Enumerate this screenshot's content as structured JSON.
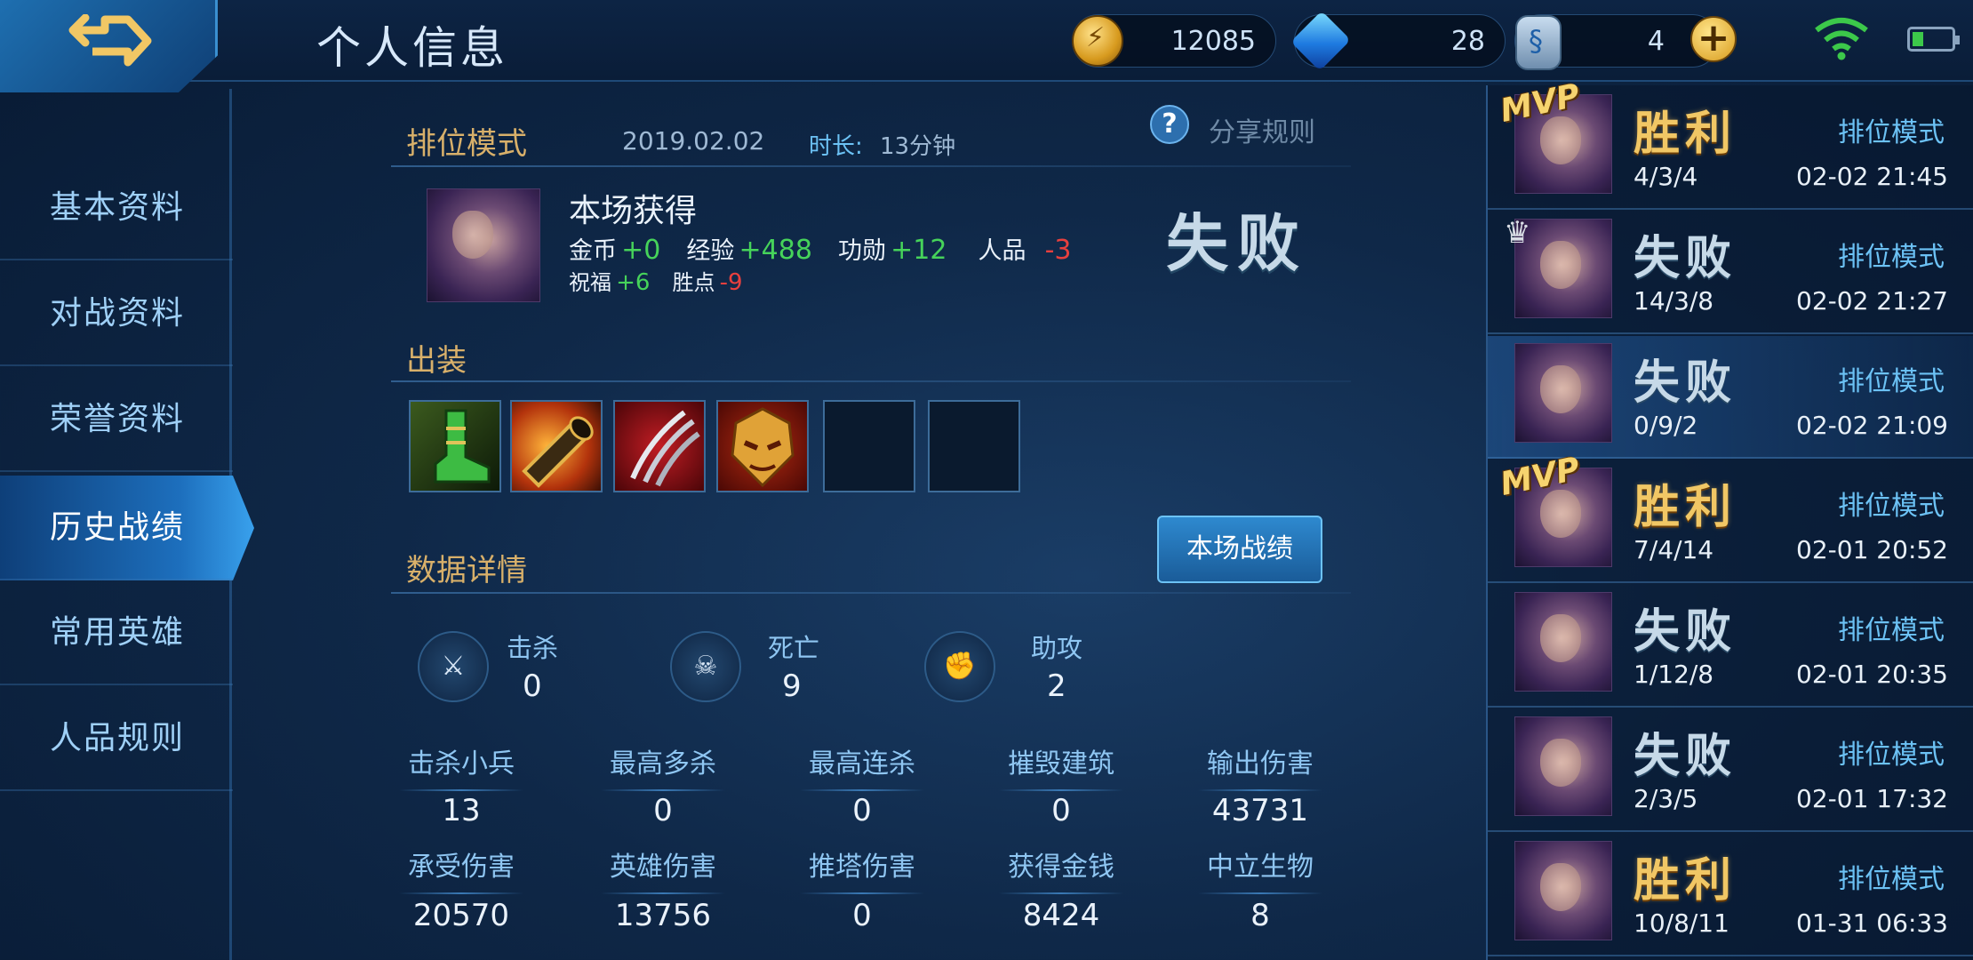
{
  "header": {
    "title": "个人信息"
  },
  "currency": {
    "gold": "12085",
    "diamond": "28",
    "coupon": "4"
  },
  "nav": {
    "items": [
      "基本资料",
      "对战资料",
      "荣誉资料",
      "历史战绩",
      "常用英雄",
      "人品规则"
    ],
    "active_index": 3
  },
  "match": {
    "mode": "排位模式",
    "date": "2019.02.02",
    "duration_label": "时长:",
    "duration": "13分钟",
    "share_rules": "分享规则",
    "rewards_title": "本场获得",
    "result": "失败",
    "rewards": {
      "gold_label": "金币",
      "gold": "+0",
      "exp_label": "经验",
      "exp": "+488",
      "merit_label": "功勋",
      "merit": "+12",
      "karma_label": "人品",
      "karma": "-3",
      "bless_label": "祝福",
      "bless": "+6",
      "points_label": "胜点",
      "points": "-9"
    },
    "equipment_title": "出装",
    "items": [
      "boots-icon",
      "horn-icon",
      "claw-icon",
      "mask-icon",
      "",
      ""
    ],
    "detail_title": "数据详情",
    "detail_button": "本场战绩",
    "kda": {
      "kill_label": "击杀",
      "kill": "0",
      "death_label": "死亡",
      "death": "9",
      "assist_label": "助攻",
      "assist": "2"
    },
    "stats": [
      {
        "label": "击杀小兵",
        "value": "13"
      },
      {
        "label": "最高多杀",
        "value": "0"
      },
      {
        "label": "最高连杀",
        "value": "0"
      },
      {
        "label": "摧毁建筑",
        "value": "0"
      },
      {
        "label": "输出伤害",
        "value": "43731"
      },
      {
        "label": "承受伤害",
        "value": "20570"
      },
      {
        "label": "英雄伤害",
        "value": "13756"
      },
      {
        "label": "推塔伤害",
        "value": "0"
      },
      {
        "label": "获得金钱",
        "value": "8424"
      },
      {
        "label": "中立生物",
        "value": "8"
      }
    ]
  },
  "history": [
    {
      "badge": "MVP",
      "result": "胜利",
      "outcome": "win",
      "mode": "排位模式",
      "kda": "4/3/4",
      "time": "02-02 21:45"
    },
    {
      "badge": "crown",
      "result": "失败",
      "outcome": "loss",
      "mode": "排位模式",
      "kda": "14/3/8",
      "time": "02-02 21:27"
    },
    {
      "badge": "",
      "result": "失败",
      "outcome": "loss",
      "mode": "排位模式",
      "kda": "0/9/2",
      "time": "02-02 21:09",
      "selected": true
    },
    {
      "badge": "MVP",
      "result": "胜利",
      "outcome": "win",
      "mode": "排位模式",
      "kda": "7/4/14",
      "time": "02-01 20:52"
    },
    {
      "badge": "",
      "result": "失败",
      "outcome": "loss",
      "mode": "排位模式",
      "kda": "1/12/8",
      "time": "02-01 20:35"
    },
    {
      "badge": "",
      "result": "失败",
      "outcome": "loss",
      "mode": "排位模式",
      "kda": "2/3/5",
      "time": "02-01 17:32"
    },
    {
      "badge": "",
      "result": "胜利",
      "outcome": "win",
      "mode": "排位模式",
      "kda": "10/8/11",
      "time": "01-31 06:33"
    }
  ]
}
